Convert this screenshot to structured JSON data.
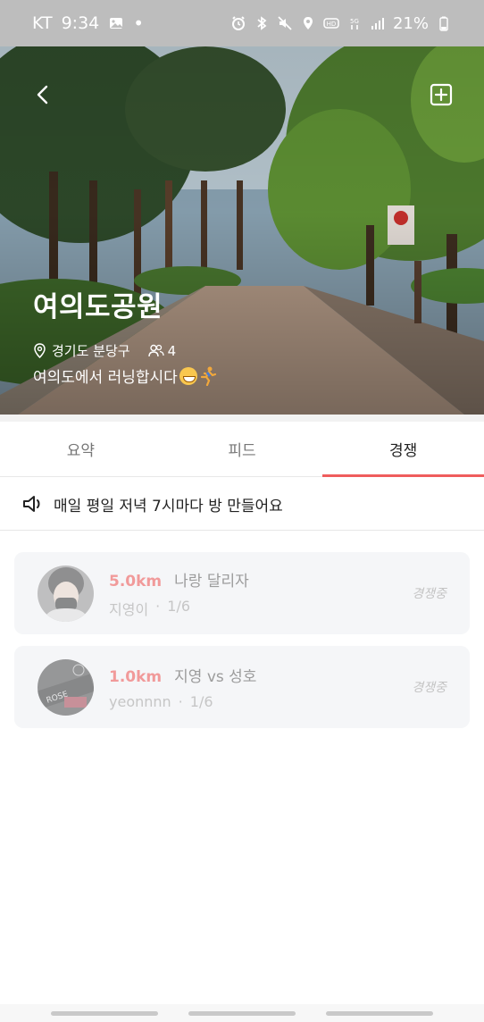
{
  "status_bar": {
    "carrier": "KT",
    "time": "9:34",
    "battery": "21%",
    "icons": [
      "image-icon",
      "alarm-icon",
      "bluetooth-icon",
      "mute-icon",
      "location-icon",
      "hd-icon",
      "5g-icon",
      "signal-icon",
      "battery-icon"
    ]
  },
  "hero": {
    "title": "여의도공원",
    "location": "경기도 분당구",
    "members": "4",
    "description": "여의도에서 러닝합시다",
    "emojis": [
      "grinning-face-emoji",
      "running-person-emoji"
    ]
  },
  "tabs": [
    {
      "label": "요약",
      "active": false
    },
    {
      "label": "피드",
      "active": false
    },
    {
      "label": "경쟁",
      "active": true
    }
  ],
  "notice": {
    "text": "매일 평일 저녁 7시마다 방 만들어요"
  },
  "competitions": [
    {
      "distance": "5.0km",
      "name": "나랑 달리자",
      "host": "지영이",
      "count": "1/6",
      "status": "경쟁중"
    },
    {
      "distance": "1.0km",
      "name": "지영 vs 성호",
      "host": "yeonnnn",
      "count": "1/6",
      "status": "경쟁중"
    }
  ],
  "colors": {
    "accent": "#ef5d5d",
    "distance": "#f19a9a",
    "card_bg": "#f5f6f8"
  }
}
